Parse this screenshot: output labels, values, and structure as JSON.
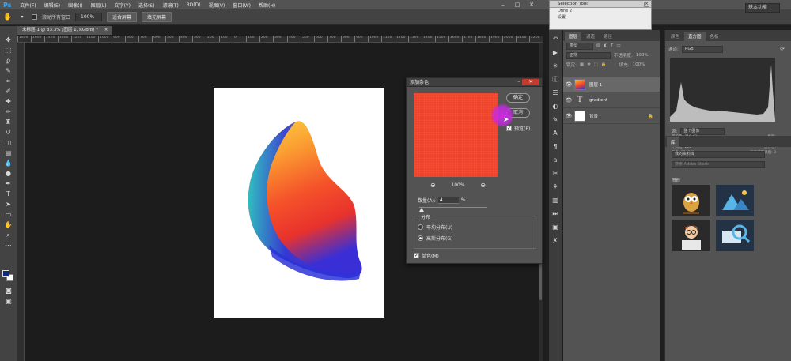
{
  "app": {
    "logo": "Ps",
    "menu": [
      "文件(F)",
      "编辑(E)",
      "图像(I)",
      "图层(L)",
      "文字(Y)",
      "选择(S)",
      "滤镜(T)",
      "3D(D)",
      "视图(V)",
      "窗口(W)",
      "帮助(H)"
    ]
  },
  "options_bar": {
    "scroll_all_label": "滚动所有窗口",
    "zoom_value": "100%",
    "fit_screen": "适合屏幕",
    "fill_screen": "填充屏幕",
    "workspace": "基本功能"
  },
  "document": {
    "tab_title": "未标题-1 @ 33.3% (图层 1, RGB/8) *",
    "ruler_ticks": [
      "1800",
      "1600",
      "1400",
      "1300",
      "1200",
      "1100",
      "1000",
      "900",
      "800",
      "700",
      "600",
      "500",
      "400",
      "300",
      "200",
      "100",
      "0",
      "100",
      "200",
      "300",
      "400",
      "500",
      "600",
      "700",
      "800",
      "900",
      "1000",
      "1100",
      "1200",
      "1300",
      "1400",
      "1500",
      "1600",
      "1700",
      "1800",
      "1900",
      "2000",
      "2100",
      "2200"
    ]
  },
  "dialog": {
    "title": "添加杂色",
    "ok": "确定",
    "cancel": "取消",
    "preview_label": "预览(P)",
    "zoom_value": "100%",
    "amount_label": "数量(A):",
    "amount_value": "4",
    "amount_unit": "%",
    "amount_fraction": 0.04,
    "distribution_label": "分布",
    "uniform_label": "平均分布(U)",
    "gaussian_label": "高斯分布(G)",
    "monochromatic_label": "单色(M)",
    "preview_color": "#f0432a"
  },
  "floating_window": {
    "title": "Selection Tool",
    "line1": "Dfine 2",
    "line2": "设置"
  },
  "layers_panel": {
    "tabs": [
      "图层",
      "通道",
      "路径"
    ],
    "filter_kind": "类型",
    "blend_mode": "正常",
    "opacity_label": "不透明度:",
    "opacity_value": "100%",
    "lock_label": "锁定:",
    "fill_label": "填充:",
    "fill_value": "100%",
    "layers": [
      {
        "name": "图层 1",
        "selected": true
      },
      {
        "name": "gradient",
        "selected": false
      },
      {
        "name": "背景",
        "selected": false
      }
    ]
  },
  "right_panel": {
    "tabs": [
      "颜色",
      "直方图",
      "色板"
    ],
    "channel_label": "通道:",
    "channel_value": "RGB",
    "source_label": "源:",
    "source_value": "整个图像",
    "stats_left": [
      "平均值: 210.43",
      "标准偏差: 63.16",
      "中间值: 255",
      "像素: 136590"
    ],
    "stats_right": [
      "色阶:",
      "数量:",
      "百分位:",
      "高速缓存级别: 3"
    ],
    "library_title": "库",
    "library_name": "我的资料库",
    "library_search": "搜索 Adobe Stock",
    "graphics_label": "图形"
  },
  "colors": {
    "accent_blue": "#31a8ff",
    "foreground": "#10297a",
    "background": "#ffffff",
    "close_red": "#c23b2e"
  }
}
